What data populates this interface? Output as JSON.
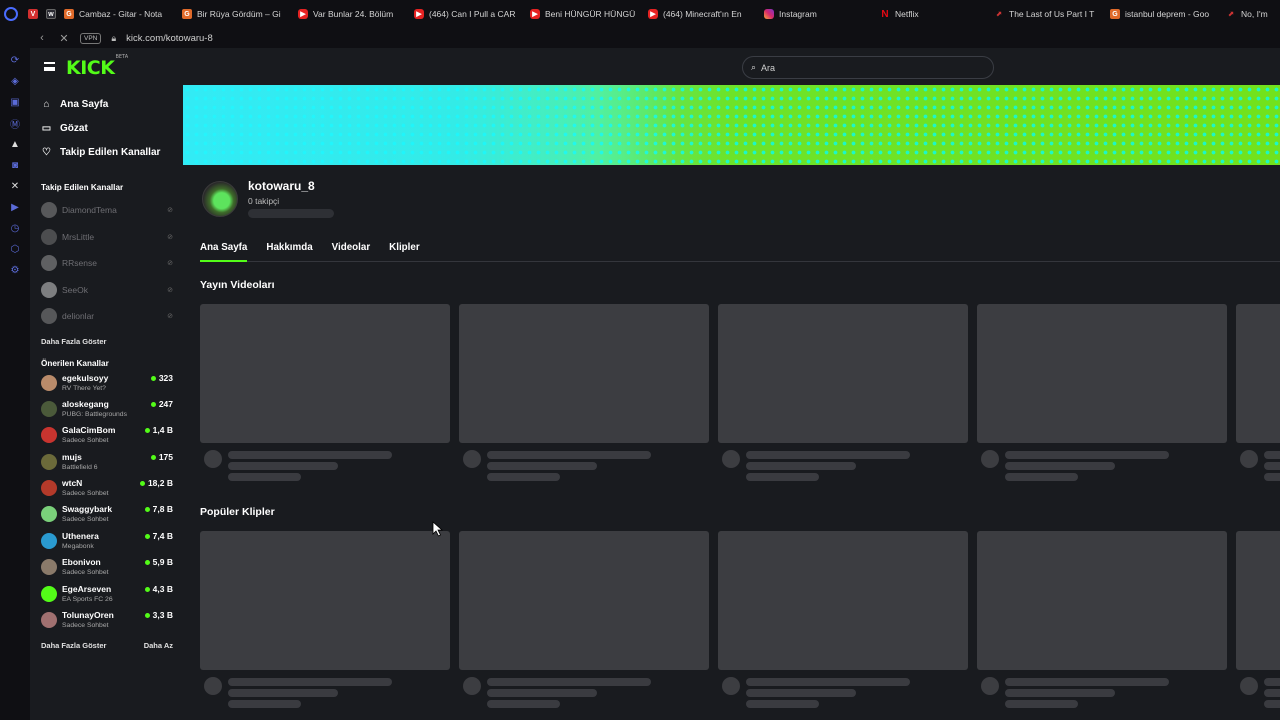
{
  "browser": {
    "tabs": [
      {
        "icon": "vivaldi-icon",
        "title": ""
      },
      {
        "icon": "w-icon",
        "title": ""
      },
      {
        "icon": "google-icon",
        "title": "Cambaz - Gitar - Nota"
      },
      {
        "icon": "google-icon",
        "title": "Bir Rüya Gördüm – Gi"
      },
      {
        "icon": "youtube-icon",
        "title": "Var Bunlar 24. Bölüm"
      },
      {
        "icon": "youtube-icon",
        "title": "(464) Can I Pull a CAR"
      },
      {
        "icon": "youtube-icon",
        "title": "Beni HÜNGÜR HÜNGÜ"
      },
      {
        "icon": "youtube-icon",
        "title": "(464) Minecraft'ın En"
      },
      {
        "icon": "instagram-icon",
        "title": "Instagram"
      },
      {
        "icon": "netflix-icon",
        "title": "Netflix"
      },
      {
        "icon": "tlou-icon",
        "title": "The Last of Us Part I T"
      },
      {
        "icon": "google-icon",
        "title": "istanbul deprem - Goo"
      },
      {
        "icon": "tlou-icon",
        "title": "No, I'm"
      }
    ],
    "vpn_label": "VPN",
    "url": "kick.com/kotowaru-8"
  },
  "site": {
    "logo": "KICK",
    "logo_tag": "BETA",
    "search_placeholder": "Ara"
  },
  "sidebar": {
    "nav": [
      {
        "icon": "home-icon",
        "label": "Ana Sayfa"
      },
      {
        "icon": "browse-icon",
        "label": "Gözat"
      },
      {
        "icon": "heart-icon",
        "label": "Takip Edilen Kanallar"
      }
    ],
    "followed_title": "Takip Edilen Kanallar",
    "followed": [
      {
        "name": "DiamondTema",
        "avatar": "#8a8a8a"
      },
      {
        "name": "MrsLittle",
        "avatar": "#777"
      },
      {
        "name": "RRsense",
        "avatar": "#999"
      },
      {
        "name": "SeeOk",
        "avatar": "#cfcfcf"
      },
      {
        "name": "delionlar",
        "avatar": "#888"
      }
    ],
    "followed_more": "Daha Fazla Göster",
    "recommended_title": "Önerilen Kanallar",
    "recommended": [
      {
        "name": "egekulsoyy",
        "category": "RV There Yet?",
        "viewers": "323",
        "avatar": "#b98b6a"
      },
      {
        "name": "aloskegang",
        "category": "PUBG: Battlegrounds",
        "viewers": "247",
        "avatar": "#4b5a3a"
      },
      {
        "name": "GalaCimBom",
        "category": "Sadece Sohbet",
        "viewers": "1,4 B",
        "avatar": "#c8342f"
      },
      {
        "name": "mujs",
        "category": "Battlefield 6",
        "viewers": "175",
        "avatar": "#6b6a3a"
      },
      {
        "name": "wtcN",
        "category": "Sadece Sohbet",
        "viewers": "18,2 B",
        "avatar": "#b43a2a"
      },
      {
        "name": "Swaggybark",
        "category": "Sadece Sohbet",
        "viewers": "7,8 B",
        "avatar": "#7ad07a"
      },
      {
        "name": "Uthenera",
        "category": "Megabonk",
        "viewers": "7,4 B",
        "avatar": "#2a9ad0"
      },
      {
        "name": "Ebonivon",
        "category": "Sadece Sohbet",
        "viewers": "5,9 B",
        "avatar": "#8a7a6a"
      },
      {
        "name": "EgeArseven",
        "category": "EA Sports FC 26",
        "viewers": "4,3 B",
        "avatar": "#53fc18"
      },
      {
        "name": "TolunayOren",
        "category": "Sadece Sohbet",
        "viewers": "3,3 B",
        "avatar": "#a07070"
      }
    ],
    "recommended_more": "Daha Fazla Göster",
    "recommended_less": "Daha Az"
  },
  "channel": {
    "name": "kotowaru_8",
    "followers": "0 takipçi",
    "tabs": [
      "Ana Sayfa",
      "Hakkımda",
      "Videolar",
      "Klipler"
    ],
    "active_tab": "Ana Sayfa",
    "section_videos": "Yayın Videoları",
    "section_clips": "Popüler Klipler"
  },
  "colors": {
    "accent": "#53fc18",
    "bg": "#191b1f",
    "skeleton": "#3c3d41"
  }
}
